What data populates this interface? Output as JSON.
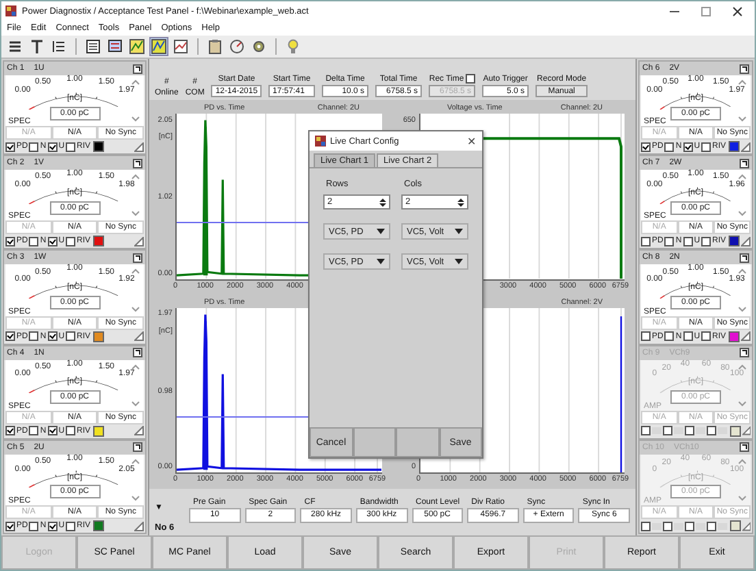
{
  "window": {
    "title": "Power Diagnostix / Acceptance Test Panel - f:\\Webinar\\example_web.act"
  },
  "menu": [
    "File",
    "Edit",
    "Connect",
    "Tools",
    "Panel",
    "Options",
    "Help"
  ],
  "left_channels": [
    {
      "channel": "Ch 1",
      "phase": "1U",
      "scale": [
        "0.00",
        "0.50",
        "1.00",
        "1.50",
        "1.97"
      ],
      "unit": "[nC]",
      "value": "0.00 pC",
      "mode": "SPEC",
      "readings": [
        "N/A",
        "N/A",
        "No Sync"
      ],
      "checks": [
        {
          "label": "PD",
          "checked": true
        },
        {
          "label": "N",
          "checked": false
        },
        {
          "label": "U",
          "checked": true
        },
        {
          "label": "RIV",
          "checked": false
        }
      ],
      "color": "#000000",
      "disabled": false
    },
    {
      "channel": "Ch 2",
      "phase": "1V",
      "scale": [
        "0.00",
        "0.50",
        "1.00",
        "1.50",
        "1.98"
      ],
      "unit": "[nC]",
      "value": "0.00 pC",
      "mode": "SPEC",
      "readings": [
        "N/A",
        "N/A",
        "No Sync"
      ],
      "checks": [
        {
          "label": "PD",
          "checked": true
        },
        {
          "label": "N",
          "checked": false
        },
        {
          "label": "U",
          "checked": true
        },
        {
          "label": "RIV",
          "checked": false
        }
      ],
      "color": "#e01010",
      "disabled": false
    },
    {
      "channel": "Ch 3",
      "phase": "1W",
      "scale": [
        "0.00",
        "0.50",
        "1.00",
        "1.50",
        "1.92"
      ],
      "unit": "[nC]",
      "value": "0.00 pC",
      "mode": "SPEC",
      "readings": [
        "N/A",
        "N/A",
        "No Sync"
      ],
      "checks": [
        {
          "label": "PD",
          "checked": true
        },
        {
          "label": "N",
          "checked": false
        },
        {
          "label": "U",
          "checked": true
        },
        {
          "label": "RIV",
          "checked": false
        }
      ],
      "color": "#e08a20",
      "disabled": false
    },
    {
      "channel": "Ch 4",
      "phase": "1N",
      "scale": [
        "0.00",
        "0.50",
        "1.00",
        "1.50",
        "1.97"
      ],
      "unit": "[nC]",
      "value": "0.00 pC",
      "mode": "SPEC",
      "readings": [
        "N/A",
        "N/A",
        "No Sync"
      ],
      "checks": [
        {
          "label": "PD",
          "checked": true
        },
        {
          "label": "N",
          "checked": false
        },
        {
          "label": "U",
          "checked": true
        },
        {
          "label": "RIV",
          "checked": false
        }
      ],
      "color": "#f0e020",
      "disabled": false
    },
    {
      "channel": "Ch 5",
      "phase": "2U",
      "scale": [
        "0.00",
        "0.50",
        "1.00",
        "1.50",
        "2.05"
      ],
      "unit": "[nC]",
      "value": "0.00 pC",
      "mode": "SPEC",
      "readings": [
        "N/A",
        "N/A",
        "No Sync"
      ],
      "checks": [
        {
          "label": "PD",
          "checked": true
        },
        {
          "label": "N",
          "checked": false
        },
        {
          "label": "U",
          "checked": true
        },
        {
          "label": "RIV",
          "checked": false
        }
      ],
      "color": "#107a20",
      "disabled": false
    }
  ],
  "header": {
    "indicators": [
      {
        "symbol": "#",
        "label": "Online"
      },
      {
        "symbol": "#",
        "label": "COM"
      }
    ],
    "fields": [
      {
        "label": "Start Date",
        "value": "12-14-2015",
        "kind": "text"
      },
      {
        "label": "Start Time",
        "value": "17:57:41",
        "kind": "text"
      },
      {
        "label": "Delta Time",
        "value": "10.0 s",
        "kind": "number"
      },
      {
        "label": "Total Time",
        "value": "6758.5 s",
        "kind": "number"
      },
      {
        "label": "Rec Time",
        "value": "6758.5 s",
        "kind": "check",
        "checked": false,
        "disabled": true
      },
      {
        "label": "Auto Trigger",
        "value": "5.0 s",
        "kind": "number"
      },
      {
        "label": "Record Mode",
        "value": "Manual",
        "kind": "button"
      }
    ]
  },
  "charts": [
    {
      "title": "PD vs. Time",
      "channel": "Channel: 2U",
      "unit": "[nC]",
      "y_ticks": [
        "2.05",
        "1.02",
        "0.00"
      ],
      "x_ticks": [
        "0",
        "1000",
        "2000",
        "3000",
        "4000"
      ],
      "kind": "spike",
      "color": "#0a7a10"
    },
    {
      "title": "Voltage vs. Time",
      "channel": "Channel: 2U",
      "y_ticks": [
        "650"
      ],
      "x_ticks": [
        "3000",
        "4000",
        "5000",
        "6000",
        "6759"
      ],
      "kind": "plateau",
      "color": "#0a7a10"
    },
    {
      "title": "PD vs. Time",
      "unit": "[nC]",
      "y_ticks": [
        "1.97",
        "0.98",
        "0.00"
      ],
      "x_ticks": [
        "0",
        "1000",
        "2000",
        "3000",
        "4000",
        "5000",
        "6000",
        "6759"
      ],
      "kind": "spike",
      "color": "#1010e0"
    },
    {
      "channel": "Channel: 2V",
      "y_ticks": [
        "0"
      ],
      "x_ticks": [
        "0",
        "1000",
        "2000",
        "3000",
        "4000",
        "5000",
        "6000",
        "6759"
      ],
      "kind": "edge",
      "color": "#1010e0"
    }
  ],
  "params": {
    "title": "No 6",
    "toggle": "▼",
    "items": [
      {
        "label": "Pre Gain",
        "value": "10"
      },
      {
        "label": "Spec Gain",
        "value": "2"
      },
      {
        "label": "CF",
        "value": "280 kHz"
      },
      {
        "label": "Bandwidth",
        "value": "300 kHz"
      },
      {
        "label": "Count Level",
        "value": "500 pC"
      },
      {
        "label": "Div Ratio",
        "value": "4596.7"
      },
      {
        "label": "Sync",
        "value": "+ Extern"
      },
      {
        "label": "Sync In",
        "value": "Sync 6"
      }
    ]
  },
  "right_channels": [
    {
      "channel": "Ch 6",
      "phase": "2V",
      "scale": [
        "0.00",
        "0.50",
        "1.00",
        "1.50",
        "1.97"
      ],
      "unit": "[nC]",
      "value": "0.00 pC",
      "mode": "SPEC",
      "readings": [
        "N/A",
        "N/A",
        "No Sync"
      ],
      "checks": [
        {
          "label": "PD",
          "checked": true
        },
        {
          "label": "N",
          "checked": false
        },
        {
          "label": "U",
          "checked": true
        },
        {
          "label": "RIV",
          "checked": false
        }
      ],
      "color": "#1020e0",
      "disabled": false
    },
    {
      "channel": "Ch 7",
      "phase": "2W",
      "scale": [
        "0.00",
        "0.50",
        "1.00",
        "1.50",
        "1.96"
      ],
      "unit": "[nC]",
      "value": "0.00 pC",
      "mode": "SPEC",
      "readings": [
        "N/A",
        "N/A",
        "No Sync"
      ],
      "checks": [
        {
          "label": "PD",
          "checked": false
        },
        {
          "label": "N",
          "checked": false
        },
        {
          "label": "U",
          "checked": false
        },
        {
          "label": "RIV",
          "checked": false
        }
      ],
      "color": "#1010b0",
      "disabled": false
    },
    {
      "channel": "Ch 8",
      "phase": "2N",
      "scale": [
        "0.00",
        "0.50",
        "1.00",
        "1.50",
        "1.93"
      ],
      "unit": "[nC]",
      "value": "0.00 pC",
      "mode": "SPEC",
      "readings": [
        "N/A",
        "N/A",
        "No Sync"
      ],
      "checks": [
        {
          "label": "PD",
          "checked": false
        },
        {
          "label": "N",
          "checked": false
        },
        {
          "label": "U",
          "checked": false
        },
        {
          "label": "RIV",
          "checked": false
        }
      ],
      "color": "#e010d0",
      "disabled": false
    },
    {
      "channel": "Ch 9",
      "phase": "VCh9",
      "scale": [
        "0",
        "20",
        "40",
        "60",
        "80",
        "100"
      ],
      "unit": "[nC]",
      "value": "0.00 pC",
      "mode": "AMP",
      "readings": [
        "N/A",
        "N/A",
        "No Sync"
      ],
      "checks": [
        {
          "checked": false
        },
        {
          "checked": false
        },
        {
          "checked": false
        },
        {
          "checked": false
        }
      ],
      "color": "#e4e4d0",
      "disabled": true
    },
    {
      "channel": "Ch 10",
      "phase": "VCh10",
      "scale": [
        "0",
        "20",
        "40",
        "60",
        "80",
        "100"
      ],
      "unit": "[nC]",
      "value": "0.00 pC",
      "mode": "AMP",
      "readings": [
        "N/A",
        "N/A",
        "No Sync"
      ],
      "checks": [
        {
          "checked": false
        },
        {
          "checked": false
        },
        {
          "checked": false
        },
        {
          "checked": false
        }
      ],
      "color": "#e4e4d0",
      "disabled": true
    }
  ],
  "dialog": {
    "title": "Live Chart Config",
    "close": "✕",
    "tabs": [
      {
        "label": "Live Chart 1",
        "selected": false
      },
      {
        "label": "Live Chart 2",
        "selected": true
      }
    ],
    "rows": {
      "label": "Rows",
      "value": "2"
    },
    "cols": {
      "label": "Cols",
      "value": "2"
    },
    "selectors": [
      [
        "VC5, PD",
        "VC5, Volt"
      ],
      [
        "VC5, PD",
        "VC5, Volt"
      ]
    ],
    "buttons": [
      {
        "kind": "text",
        "label": "Cancel"
      },
      {
        "kind": "blank"
      },
      {
        "kind": "blank"
      },
      {
        "kind": "text",
        "label": "Save"
      }
    ]
  },
  "buttons": [
    {
      "label": "Logon",
      "disabled": true
    },
    {
      "label": "SC Panel",
      "disabled": false
    },
    {
      "label": "MC Panel",
      "disabled": false
    },
    {
      "label": "Load",
      "disabled": false
    },
    {
      "label": "Save",
      "disabled": false
    },
    {
      "label": "Search",
      "disabled": false
    },
    {
      "label": "Export",
      "disabled": false
    },
    {
      "label": "Print",
      "disabled": true
    },
    {
      "label": "Report",
      "disabled": false
    },
    {
      "label": "Exit",
      "disabled": false
    }
  ]
}
